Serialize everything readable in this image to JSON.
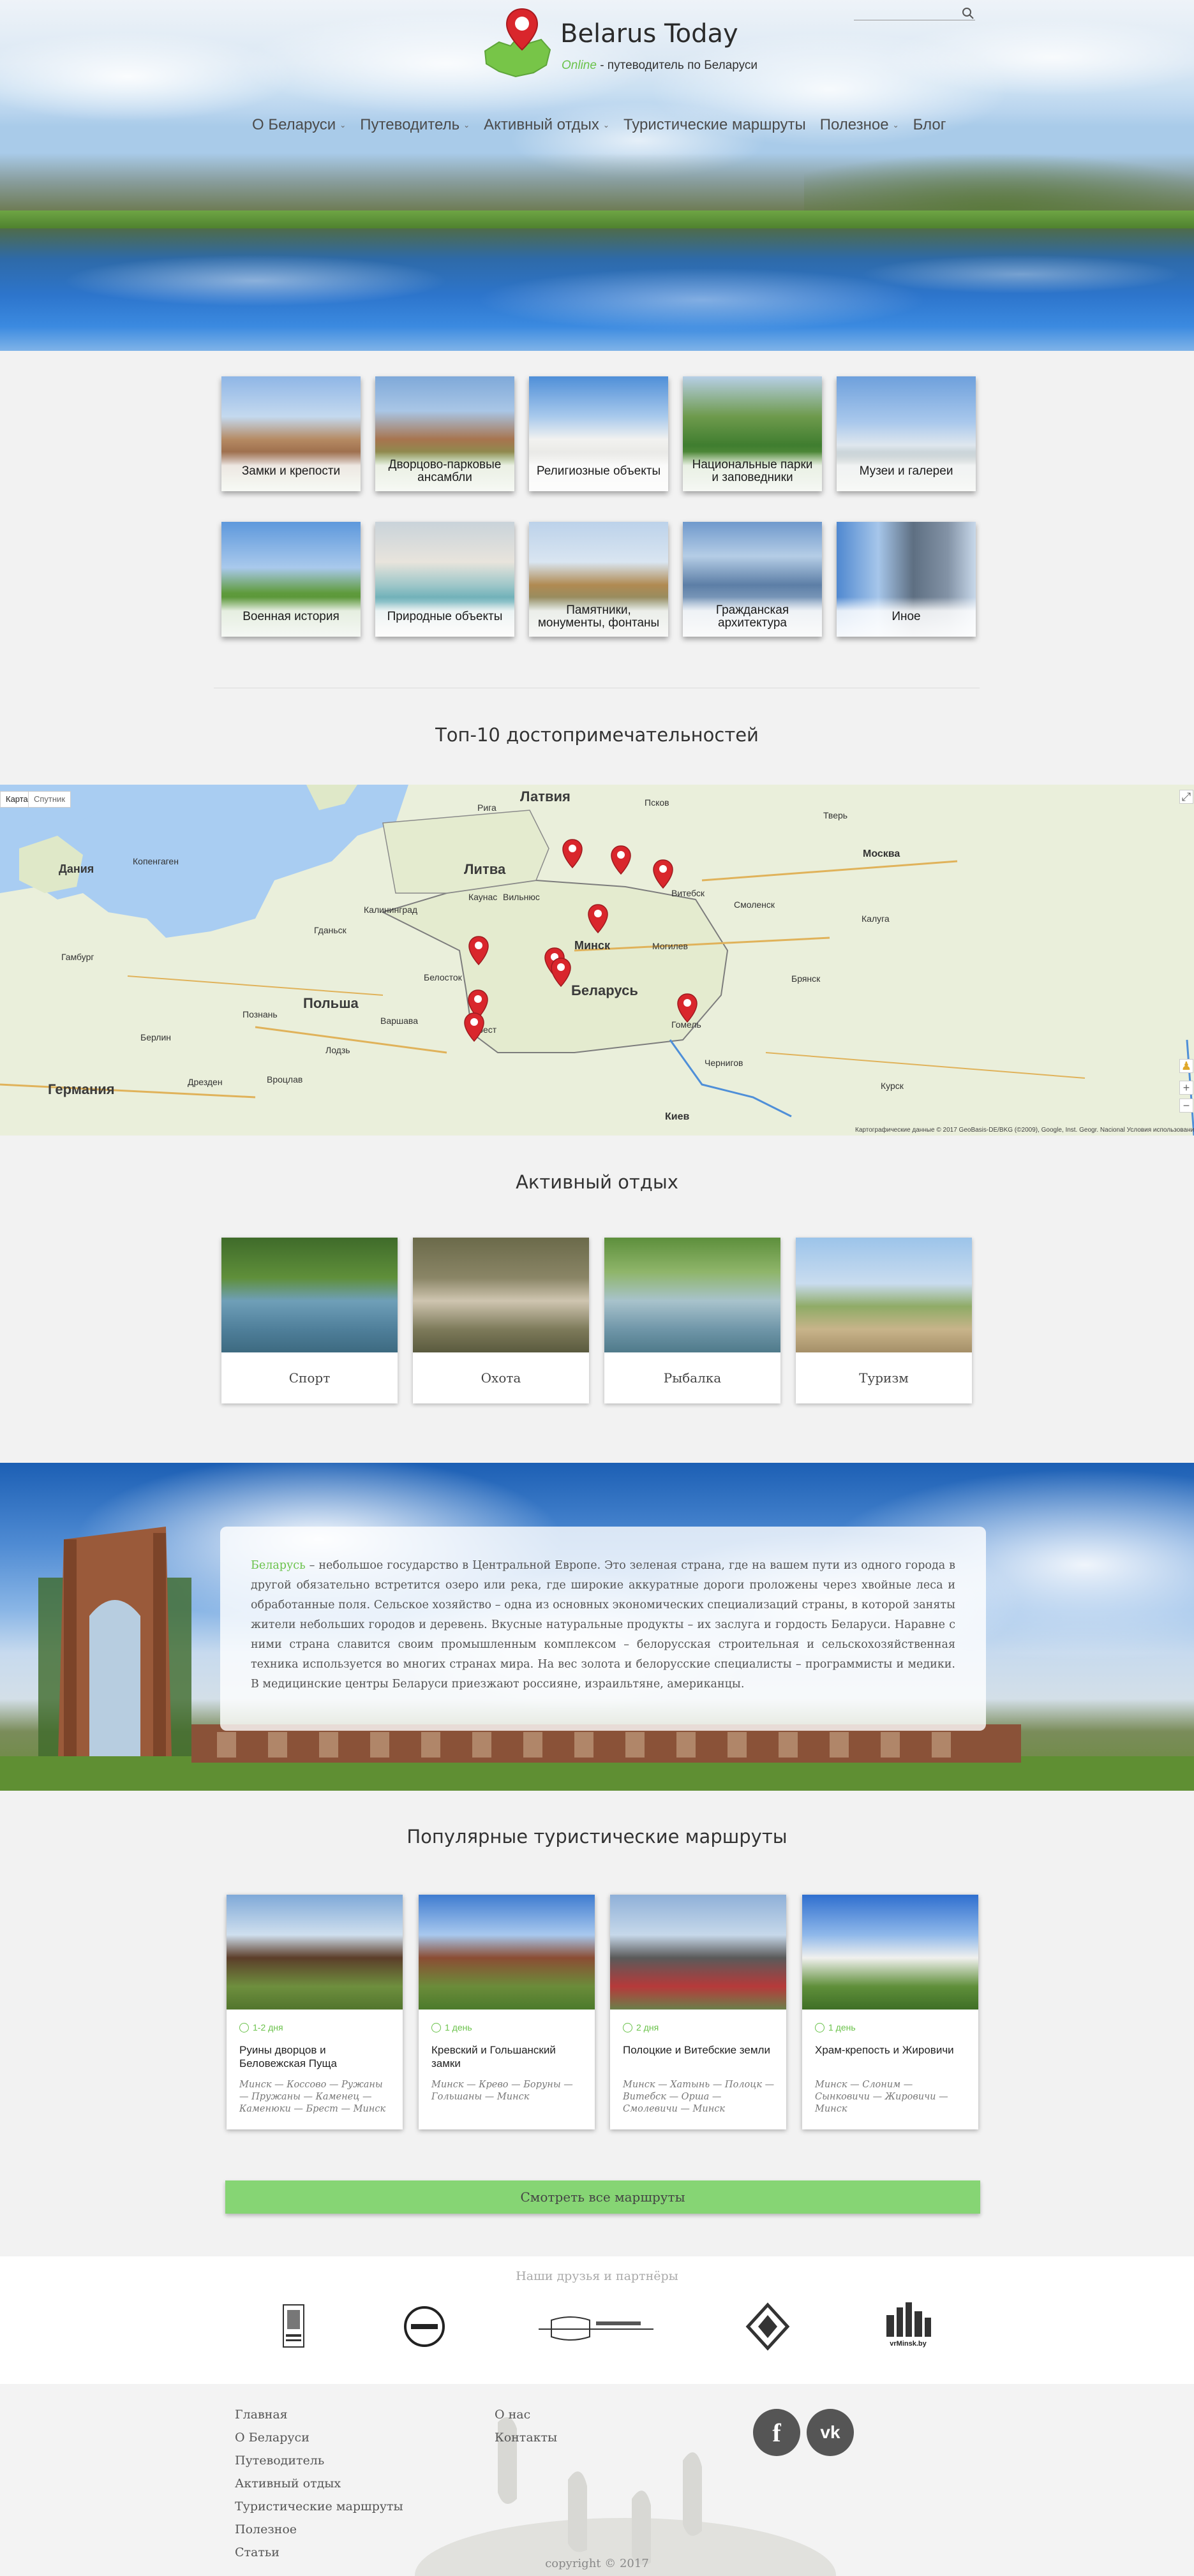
{
  "site": {
    "name": "Belarus Today",
    "tagline_online": "Online",
    "tagline_rest": " - путеводитель по Беларуси"
  },
  "nav": [
    {
      "label": "О Беларуси",
      "dropdown": true
    },
    {
      "label": "Путеводитель",
      "dropdown": true
    },
    {
      "label": "Активный отдых",
      "dropdown": true
    },
    {
      "label": "Туристические маршруты",
      "dropdown": false
    },
    {
      "label": "Полезное",
      "dropdown": true
    },
    {
      "label": "Блог",
      "dropdown": false
    }
  ],
  "categories": [
    {
      "label": "Замки и крепости"
    },
    {
      "label": "Дворцово-парковые ансамбли"
    },
    {
      "label": "Религиозные объекты"
    },
    {
      "label": "Национальные парки и заповедники"
    },
    {
      "label": "Музеи и галереи"
    },
    {
      "label": "Военная история"
    },
    {
      "label": "Природные объекты"
    },
    {
      "label": "Памятники, монументы, фонтаны"
    },
    {
      "label": "Гражданская архитектура"
    },
    {
      "label": "Иное"
    }
  ],
  "top10": {
    "title": "Топ-10 достопримечательностей",
    "map": {
      "tab_map": "Карта",
      "tab_sat": "Спутник",
      "copyright": "Картографические данные © 2017 GeoBasis-DE/BKG (©2009), Google, Inst. Geogr. Nacional   Условия использования",
      "labels": [
        {
          "text": "Латвия",
          "kind": "country"
        },
        {
          "text": "Литва",
          "kind": "country"
        },
        {
          "text": "Беларусь",
          "kind": "country"
        },
        {
          "text": "Польша",
          "kind": "country"
        },
        {
          "text": "Германия",
          "kind": "country"
        },
        {
          "text": "Дания",
          "kind": "country"
        },
        {
          "text": "Минск",
          "kind": "city"
        },
        {
          "text": "Вильнюс",
          "kind": "city"
        },
        {
          "text": "Рига",
          "kind": "city"
        },
        {
          "text": "Варшава",
          "kind": "city"
        },
        {
          "text": "Москва",
          "kind": "city"
        },
        {
          "text": "Смоленск",
          "kind": "city"
        },
        {
          "text": "Киев",
          "kind": "city"
        },
        {
          "text": "Калининград",
          "kind": "city"
        },
        {
          "text": "Гданьск",
          "kind": "city"
        },
        {
          "text": "Берлин",
          "kind": "city"
        },
        {
          "text": "Гамбург",
          "kind": "city"
        },
        {
          "text": "Копенгаген",
          "kind": "city"
        },
        {
          "text": "Белосток",
          "kind": "city"
        },
        {
          "text": "Брест",
          "kind": "city"
        },
        {
          "text": "Гомель",
          "kind": "city"
        },
        {
          "text": "Могилев",
          "kind": "city"
        },
        {
          "text": "Витебск",
          "kind": "city"
        },
        {
          "text": "Псков",
          "kind": "city"
        },
        {
          "text": "Каунас",
          "kind": "city"
        },
        {
          "text": "Курск",
          "kind": "city"
        },
        {
          "text": "Брянск",
          "kind": "city"
        },
        {
          "text": "Калуга",
          "kind": "city"
        },
        {
          "text": "Тверь",
          "kind": "city"
        },
        {
          "text": "Лодзь",
          "kind": "city"
        },
        {
          "text": "Познань",
          "kind": "city"
        },
        {
          "text": "Вроцлав",
          "kind": "city"
        },
        {
          "text": "Дрезден",
          "kind": "city"
        },
        {
          "text": "Чернигов",
          "kind": "city"
        }
      ]
    }
  },
  "active": {
    "title": "Активный отдых",
    "items": [
      {
        "label": "Спорт"
      },
      {
        "label": "Охота"
      },
      {
        "label": "Рыбалка"
      },
      {
        "label": "Туризм"
      }
    ]
  },
  "banner": {
    "highlight": "Беларусь",
    "text": " – небольшое государство в Центральной Европе. Это зеленая страна, где на вашем пути из одного города в другой обязательно встретится озеро или река, где широкие аккуратные дороги проложены через хвойные леса и обработанные поля. Сельское хозяйство – одна из основных экономических специализаций страны, в которой заняты жители небольших городов и деревень. Вкусные натуральные продукты – их заслуга и гордость Беларуси. Наравне с ними страна славится своим промышленным комплексом – белорусская строительная и сельскохозяйственная техника используется во многих странах мира. На вес золота и белорусские специалисты – программисты и медики. В медицинские центры Беларуси приезжают россияне, израильтяне, американцы."
  },
  "routes": {
    "title": "Популярные туристические маршруты",
    "items": [
      {
        "duration": "1-2 дня",
        "name": "Руины дворцов и Беловежская Пуща",
        "path": "Минск — Коссово — Ружаны — Пружаны — Каменец — Каменюки — Брест — Минск"
      },
      {
        "duration": "1 день",
        "name": "Кревский и Гольшанский замки",
        "path": "Минск — Крево — Боруны — Гольшаны — Минск"
      },
      {
        "duration": "2 дня",
        "name": "Полоцкие и Витебские земли",
        "path": "Минск — Хатынь — Полоцк — Витебск — Орша — Смолевичи — Минск"
      },
      {
        "duration": "1 день",
        "name": "Храм-крепость и Жировичи",
        "path": "Минск — Слоним — Сынковичи — Жировичи — Минск"
      }
    ],
    "all_button": "Смотреть все маршруты"
  },
  "partners": {
    "title": "Наши друзья и партнёры",
    "logos": [
      {
        "name": "partner-logo-1"
      },
      {
        "name": "partner-logo-vrminsk"
      },
      {
        "name": "partner-logo-express"
      },
      {
        "name": "partner-logo-ornament"
      },
      {
        "name": "partner-logo-vrminsk-by",
        "text": "vrMinsk.by"
      }
    ]
  },
  "footer": {
    "col1": [
      "Главная",
      "О Беларуси",
      "Путеводитель",
      "Активный отдых",
      "Туристические маршруты",
      "Полезное",
      "Статьи"
    ],
    "col2": [
      "О нас",
      "Контакты"
    ],
    "social": [
      {
        "icon": "facebook-icon",
        "glyph": "f"
      },
      {
        "icon": "vk-icon",
        "glyph": "vk"
      }
    ],
    "copyright": "copyright © 2017"
  },
  "colors": {
    "accent_green": "#6ac24a",
    "button_green": "#86d574",
    "pin_red": "#d9262c"
  }
}
